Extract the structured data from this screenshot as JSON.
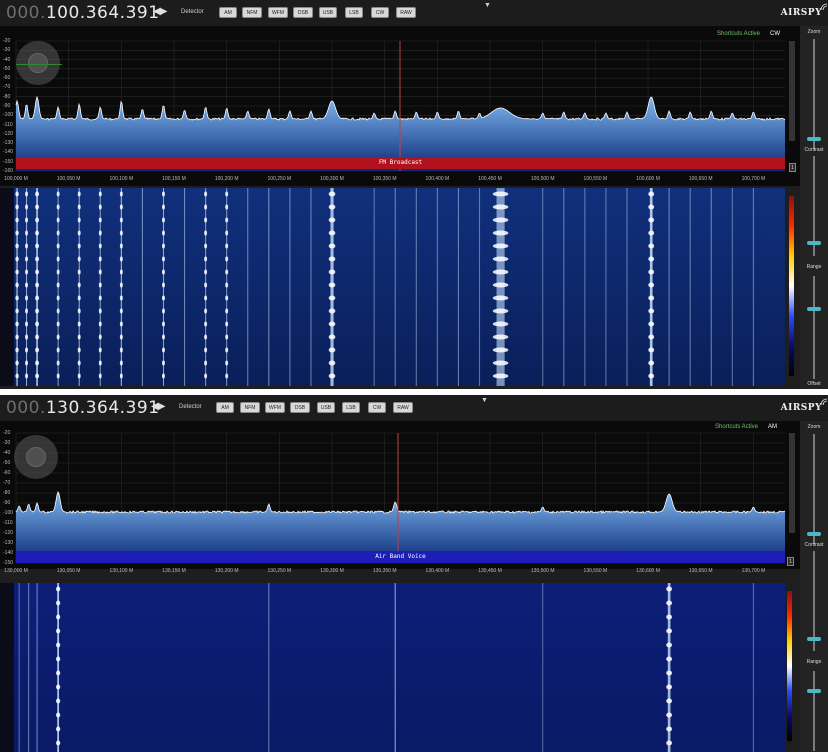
{
  "colors": {
    "panel_bg": "#1e1e1e",
    "spectrum_fill_top": "#7fb6ee",
    "spectrum_fill_bottom": "#0a2a78",
    "center_line": "#c04040",
    "fm_band": "#b2121e",
    "air_band": "#1d1db8",
    "shortcuts_text": "#6ec46e",
    "knob": "#4ab8c8"
  },
  "panels": [
    {
      "frequency_prefix": "000.",
      "frequency_main": "100.364.391",
      "detector_label": "Detector",
      "modes": [
        "AM",
        "NFM",
        "WFM",
        "DSB",
        "USB",
        "LSB",
        "CW",
        "RAW"
      ],
      "logo": "AIRSPY",
      "shortcuts": "Shortcuts Active",
      "active_mode": "CW",
      "band_label": "FM Broadcast",
      "y_ticks": [
        "-20",
        "-30",
        "-40",
        "-50",
        "-60",
        "-70",
        "-80",
        "-90",
        "-100",
        "-110",
        "-120",
        "-130",
        "-140",
        "-150",
        "-160"
      ],
      "x_ticks": [
        "100,000 M",
        "100,050 M",
        "100,100 M",
        "100,150 M",
        "100,200 M",
        "100,250 M",
        "100,300 M",
        "100,350 M",
        "100,400 M",
        "100,450 M",
        "100,500 M",
        "100,550 M",
        "100,600 M",
        "100,650 M",
        "100,700 M"
      ],
      "one_box": "1",
      "zoom_label": "Zoom",
      "contrast_label": "Contrast",
      "range_label": "Range",
      "offset_label": "Offset",
      "peaks": [
        {
          "x": 100001,
          "h": 18,
          "w": 1.5
        },
        {
          "x": 100010,
          "h": 15,
          "w": 1.2
        },
        {
          "x": 100020,
          "h": 22,
          "w": 1.8
        },
        {
          "x": 100040,
          "h": 12,
          "w": 1.2
        },
        {
          "x": 100060,
          "h": 15,
          "w": 1.2
        },
        {
          "x": 100080,
          "h": 12,
          "w": 1.2
        },
        {
          "x": 100100,
          "h": 18,
          "w": 1.2
        },
        {
          "x": 100120,
          "h": 10,
          "w": 1.2
        },
        {
          "x": 100140,
          "h": 14,
          "w": 1.2
        },
        {
          "x": 100160,
          "h": 9,
          "w": 1.2
        },
        {
          "x": 100180,
          "h": 12,
          "w": 1.2
        },
        {
          "x": 100200,
          "h": 11,
          "w": 1.2
        },
        {
          "x": 100220,
          "h": 8,
          "w": 1.2
        },
        {
          "x": 100240,
          "h": 10,
          "w": 1.2
        },
        {
          "x": 100260,
          "h": 8,
          "w": 1.2
        },
        {
          "x": 100280,
          "h": 8,
          "w": 1.2
        },
        {
          "x": 100300,
          "h": 18,
          "w": 3.5
        },
        {
          "x": 100340,
          "h": 6,
          "w": 1.2
        },
        {
          "x": 100360,
          "h": 8,
          "w": 1.2
        },
        {
          "x": 100380,
          "h": 7,
          "w": 1.2
        },
        {
          "x": 100400,
          "h": 7,
          "w": 1.2
        },
        {
          "x": 100420,
          "h": 8,
          "w": 1.2
        },
        {
          "x": 100440,
          "h": 6,
          "w": 1.2
        },
        {
          "x": 100460,
          "h": 11,
          "w": 9
        },
        {
          "x": 100500,
          "h": 6,
          "w": 1.2
        },
        {
          "x": 100520,
          "h": 7,
          "w": 1.2
        },
        {
          "x": 100540,
          "h": 6,
          "w": 1.2
        },
        {
          "x": 100560,
          "h": 6,
          "w": 1.2
        },
        {
          "x": 100580,
          "h": 7,
          "w": 1.2
        },
        {
          "x": 100603,
          "h": 22,
          "w": 3
        },
        {
          "x": 100620,
          "h": 8,
          "w": 1.2
        },
        {
          "x": 100640,
          "h": 7,
          "w": 1.2
        },
        {
          "x": 100660,
          "h": 8,
          "w": 1.2
        },
        {
          "x": 100680,
          "h": 6,
          "w": 1.2
        },
        {
          "x": 100700,
          "h": 7,
          "w": 1.2
        }
      ]
    },
    {
      "frequency_prefix": "000.",
      "frequency_main": "130.364.391",
      "detector_label": "Detector",
      "modes": [
        "AM",
        "NFM",
        "WFM",
        "DSB",
        "USB",
        "LSB",
        "CW",
        "RAW"
      ],
      "logo": "AIRSPY",
      "shortcuts": "Shortcuts Active",
      "active_mode": "AM",
      "band_label": "Air Band Voice",
      "y_ticks": [
        "-20",
        "-30",
        "-40",
        "-50",
        "-60",
        "-70",
        "-80",
        "-90",
        "-100",
        "-110",
        "-120",
        "-130",
        "-140",
        "-150"
      ],
      "x_ticks": [
        "130,000 M",
        "130,050 M",
        "130,100 M",
        "130,150 M",
        "130,200 M",
        "130,250 M",
        "130,300 M",
        "130,350 M",
        "130,400 M",
        "130,450 M",
        "130,500 M",
        "130,550 M",
        "130,600 M",
        "130,650 M",
        "130,700 M"
      ],
      "one_box": "1",
      "zoom_label": "Zoom",
      "contrast_label": "Contrast",
      "range_label": "Range",
      "peaks": [
        {
          "x": 130003,
          "h": 6,
          "w": 1.2
        },
        {
          "x": 130012,
          "h": 8,
          "w": 1.2
        },
        {
          "x": 130020,
          "h": 9,
          "w": 1.2
        },
        {
          "x": 130040,
          "h": 20,
          "w": 2
        },
        {
          "x": 130240,
          "h": 8,
          "w": 1.2
        },
        {
          "x": 130360,
          "h": 10,
          "w": 1.5
        },
        {
          "x": 130500,
          "h": 5,
          "w": 1.2
        },
        {
          "x": 130620,
          "h": 18,
          "w": 3
        },
        {
          "x": 130700,
          "h": 5,
          "w": 1.2
        }
      ]
    }
  ]
}
